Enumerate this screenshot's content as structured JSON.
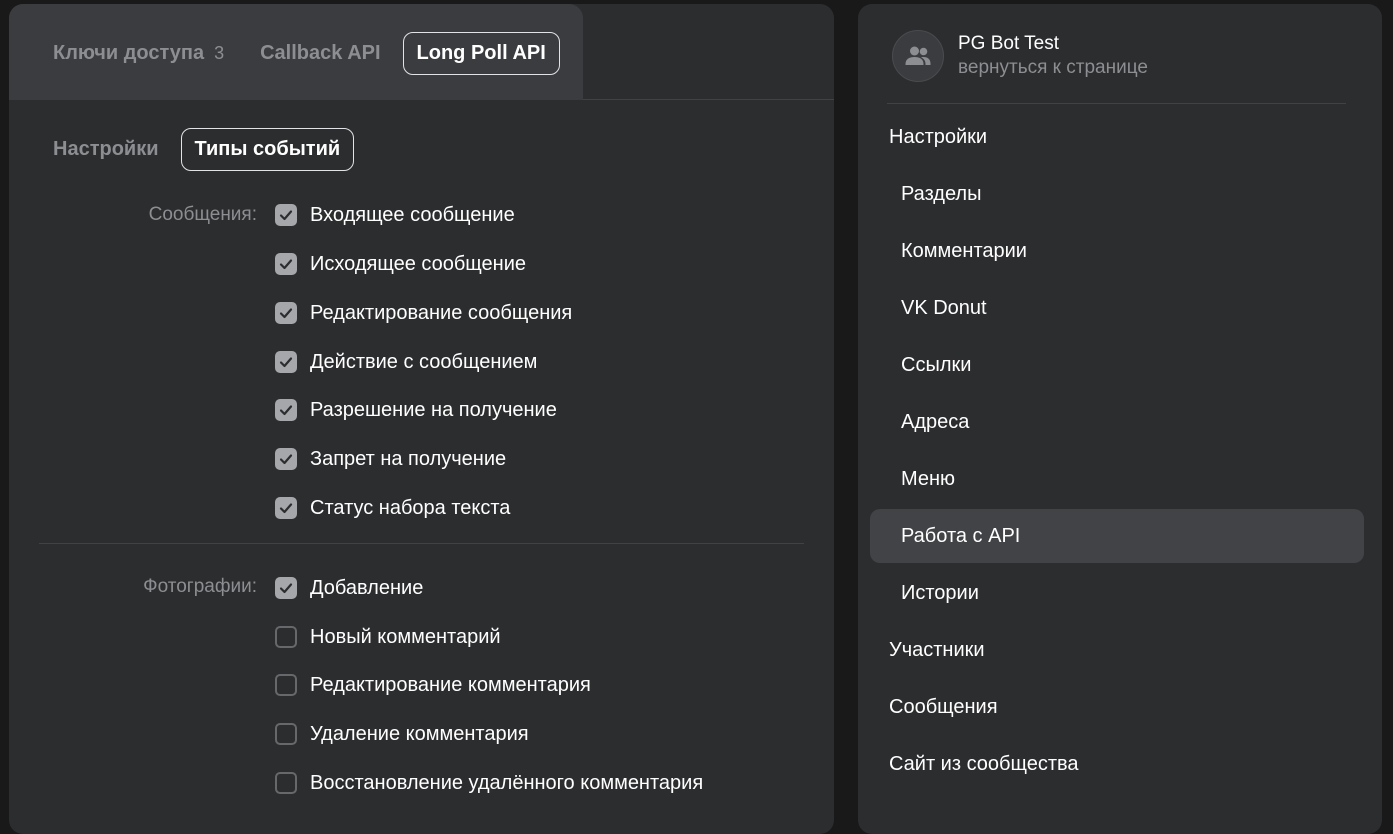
{
  "tabs": [
    {
      "label": "Ключи доступа",
      "count": "3"
    },
    {
      "label": "Callback API"
    },
    {
      "label": "Long Poll API"
    }
  ],
  "subtabs": [
    {
      "label": "Настройки"
    },
    {
      "label": "Типы событий"
    }
  ],
  "groups": [
    {
      "label": "Сообщения:",
      "items": [
        {
          "label": "Входящее сообщение",
          "checked": true
        },
        {
          "label": "Исходящее сообщение",
          "checked": true
        },
        {
          "label": "Редактирование сообщения",
          "checked": true
        },
        {
          "label": "Действие с сообщением",
          "checked": true
        },
        {
          "label": "Разрешение на получение",
          "checked": true
        },
        {
          "label": "Запрет на получение",
          "checked": true
        },
        {
          "label": "Статус набора текста",
          "checked": true
        }
      ]
    },
    {
      "label": "Фотографии:",
      "items": [
        {
          "label": "Добавление",
          "checked": true
        },
        {
          "label": "Новый комментарий",
          "checked": false
        },
        {
          "label": "Редактирование комментария",
          "checked": false
        },
        {
          "label": "Удаление комментария",
          "checked": false
        },
        {
          "label": "Восстановление удалённого комментария",
          "checked": false
        }
      ]
    }
  ],
  "community": {
    "name": "PG Bot Test",
    "back_link": "вернуться к странице",
    "avatar_icon": "users-icon"
  },
  "sidebar": {
    "items": [
      {
        "label": "Настройки"
      },
      {
        "label": "Разделы"
      },
      {
        "label": "Комментарии"
      },
      {
        "label": "VK Donut"
      },
      {
        "label": "Ссылки"
      },
      {
        "label": "Адреса"
      },
      {
        "label": "Меню"
      },
      {
        "label": "Работа с API"
      },
      {
        "label": "Истории"
      },
      {
        "label": "Участники"
      },
      {
        "label": "Сообщения"
      },
      {
        "label": "Сайт из сообщества"
      }
    ]
  },
  "colors": {
    "panel": "#2c2d2f",
    "tab_area": "#3b3c3f",
    "checkbox_checked": "#a6a7ab",
    "active_nav": "#424346",
    "text_primary": "#ffffff",
    "text_secondary": "#8d8e92"
  }
}
